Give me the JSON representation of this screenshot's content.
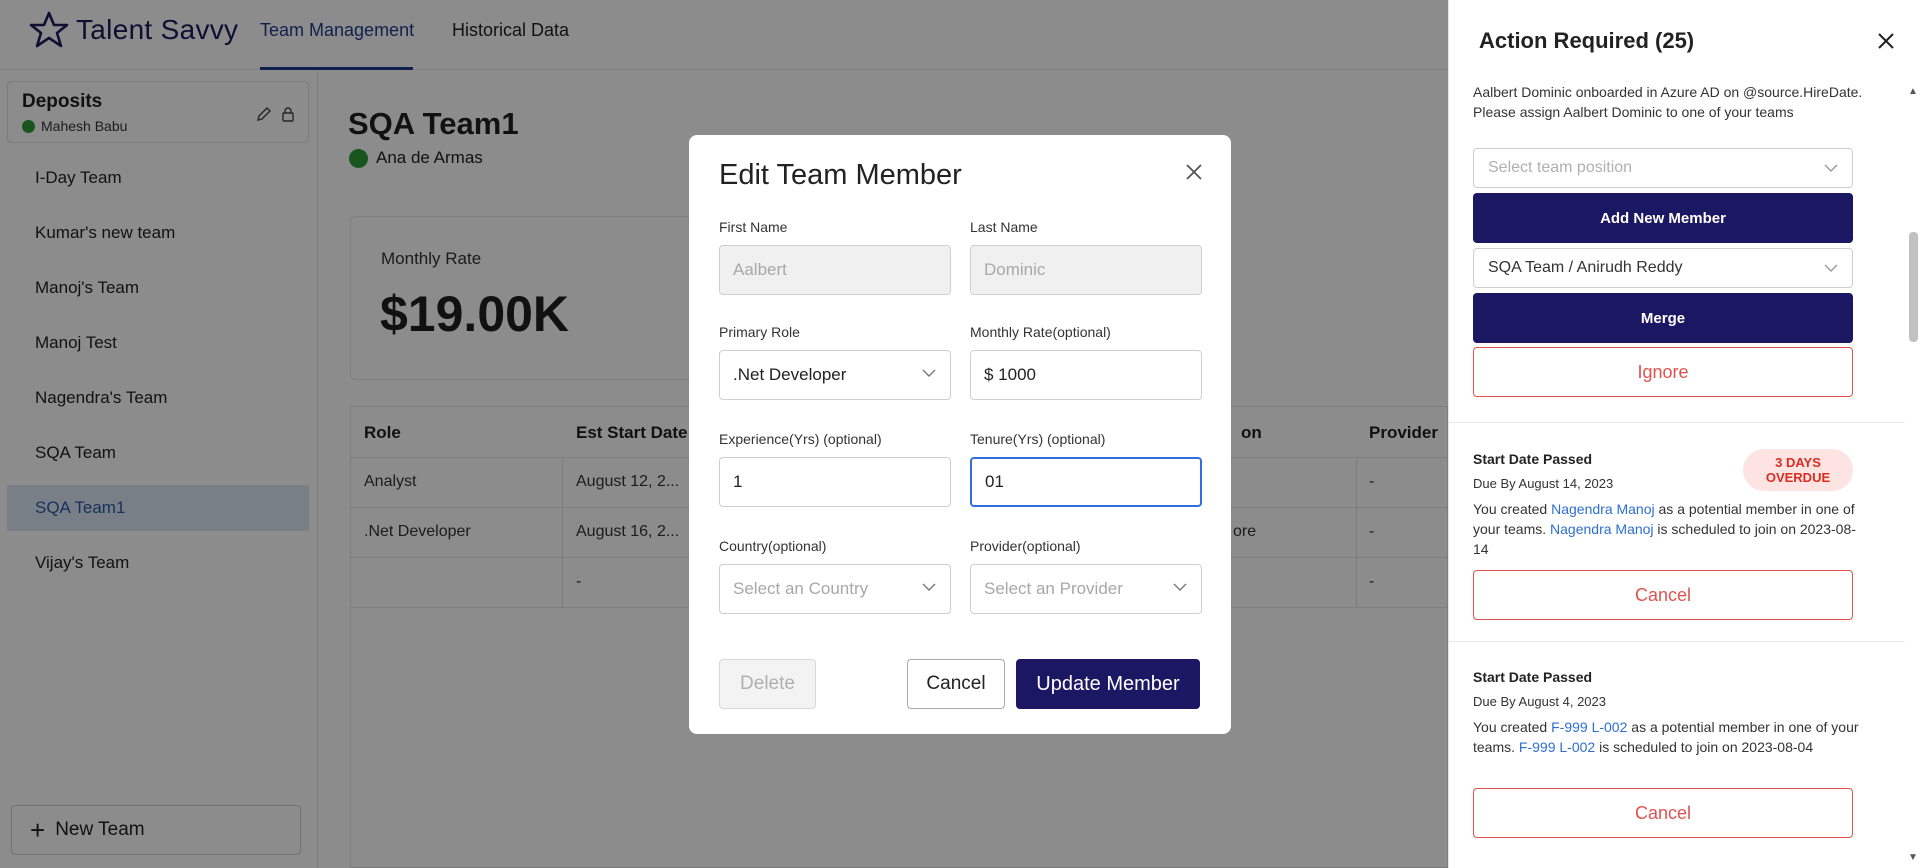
{
  "app": {
    "brand": "Talent Savvy"
  },
  "nav": {
    "tabs": [
      {
        "label": "Team Management"
      },
      {
        "label": "Historical Data"
      }
    ]
  },
  "sidebar": {
    "group_title": "Deposits",
    "group_owner": "Mahesh Babu",
    "teams": [
      {
        "label": "I-Day Team"
      },
      {
        "label": "Kumar's new team"
      },
      {
        "label": "Manoj's Team"
      },
      {
        "label": "Manoj Test"
      },
      {
        "label": "Nagendra's Team"
      },
      {
        "label": "SQA Team"
      },
      {
        "label": "SQA Team1"
      },
      {
        "label": "Vijay's Team"
      }
    ],
    "new_team_label": "New Team"
  },
  "main": {
    "title": "SQA Team1",
    "owner": "Ana de Armas",
    "monthly_rate_label": "Monthly Rate",
    "monthly_rate_value": "$19.00K",
    "table": {
      "headers": {
        "role": "Role",
        "est_start": "Est Start Date",
        "location": "on",
        "provider": "Provider"
      },
      "rows": [
        {
          "role": "Analyst",
          "est_start": "August 12, 2...",
          "location": "",
          "provider": "-"
        },
        {
          "role": ".Net Developer",
          "est_start": "August 16, 2...",
          "location": "ore",
          "provider": "-"
        },
        {
          "role": "",
          "est_start": "-",
          "location": "",
          "provider": "-"
        }
      ]
    }
  },
  "modal": {
    "title": "Edit Team Member",
    "first_name_label": "First Name",
    "first_name_value": "Aalbert",
    "last_name_label": "Last Name",
    "last_name_value": "Dominic",
    "primary_role_label": "Primary Role",
    "primary_role_value": ".Net Developer",
    "monthly_rate_label": "Monthly Rate(optional)",
    "monthly_rate_value": "$ 1000",
    "experience_label": "Experience(Yrs) (optional)",
    "experience_value": "1",
    "tenure_label": "Tenure(Yrs) (optional)",
    "tenure_value": "01",
    "country_label": "Country(optional)",
    "country_placeholder": "Select an Country",
    "provider_label": "Provider(optional)",
    "provider_placeholder": "Select an Provider",
    "delete_label": "Delete",
    "cancel_label": "Cancel",
    "update_label": "Update Member"
  },
  "panel": {
    "title": "Action Required (25)",
    "item1": {
      "message": "Aalbert Dominic onboarded in Azure AD on @source.HireDate. Please assign Aalbert Dominic to one of your teams",
      "position_placeholder": "Select team position",
      "add_label": "Add New Member",
      "merge_select": "SQA Team / Anirudh Reddy",
      "merge_label": "Merge",
      "ignore_label": "Ignore"
    },
    "item2": {
      "heading": "Start Date Passed",
      "badge": "3 DAYS OVERDUE",
      "due": "Due By August 14, 2023",
      "text_a": "You created ",
      "link_a": "Nagendra Manoj",
      "text_b": " as a potential member in one of your teams. ",
      "link_b": "Nagendra Manoj",
      "text_c": " is scheduled to join on 2023-08-14",
      "cancel_label": "Cancel"
    },
    "item3": {
      "heading": "Start Date Passed",
      "due": "Due By August 4, 2023",
      "text_a": "You created ",
      "link_a": "F-999 L-002",
      "text_b": " as a potential member in one of your teams. ",
      "link_b": "F-999 L-002",
      "text_c": " is scheduled to join on 2023-08-04",
      "cancel_label": "Cancel"
    }
  },
  "colors": {
    "brand": "#1b1763",
    "accent_blue": "#2f6fe0",
    "danger": "#e0534f",
    "status_green": "#2e9b3a",
    "selected_bg": "#dbe8f6"
  },
  "icons": [
    "star-logo-icon",
    "edit-icon",
    "lock-icon",
    "plus-icon",
    "close-icon",
    "chevron-down-icon"
  ]
}
